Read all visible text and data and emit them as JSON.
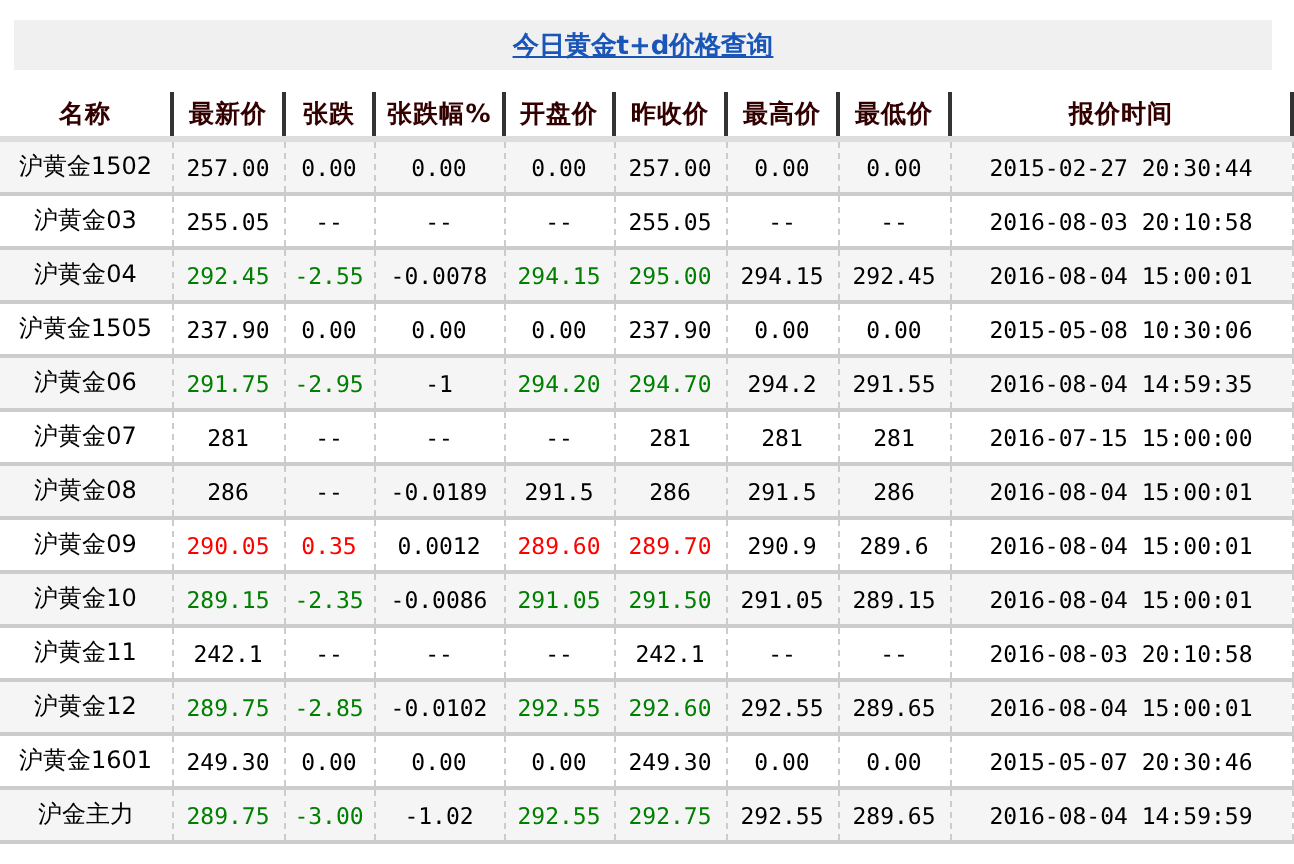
{
  "title": "今日黄金t+d价格查询",
  "columns": [
    {
      "label": "名称",
      "tinted": false
    },
    {
      "label": "最新价",
      "tinted": true
    },
    {
      "label": "张跌",
      "tinted": true
    },
    {
      "label": "张跌幅%",
      "tinted": false
    },
    {
      "label": "开盘价",
      "tinted": true
    },
    {
      "label": "昨收价",
      "tinted": true
    },
    {
      "label": "最高价",
      "tinted": false
    },
    {
      "label": "最低价",
      "tinted": false
    },
    {
      "label": "报价时间",
      "tinted": false
    }
  ],
  "rows": [
    {
      "color": "#000000",
      "cells": [
        "沪黄金1502",
        "257.00",
        "0.00",
        "0.00",
        "0.00",
        "257.00",
        "0.00",
        "0.00",
        "2015-02-27 20:30:44"
      ]
    },
    {
      "color": "#000000",
      "cells": [
        "沪黄金03",
        "255.05",
        "--",
        "--",
        "--",
        "255.05",
        "--",
        "--",
        "2016-08-03 20:10:58"
      ]
    },
    {
      "color": "#008000",
      "cells": [
        "沪黄金04",
        "292.45",
        "-2.55",
        "-0.0078",
        "294.15",
        "295.00",
        "294.15",
        "292.45",
        "2016-08-04 15:00:01"
      ]
    },
    {
      "color": "#000000",
      "cells": [
        "沪黄金1505",
        "237.90",
        "0.00",
        "0.00",
        "0.00",
        "237.90",
        "0.00",
        "0.00",
        "2015-05-08 10:30:06"
      ]
    },
    {
      "color": "#008000",
      "cells": [
        "沪黄金06",
        "291.75",
        "-2.95",
        "-1",
        "294.20",
        "294.70",
        "294.2",
        "291.55",
        "2016-08-04 14:59:35"
      ]
    },
    {
      "color": "#000000",
      "cells": [
        "沪黄金07",
        "281",
        "--",
        "--",
        "--",
        "281",
        "281",
        "281",
        "2016-07-15 15:00:00"
      ]
    },
    {
      "color": "#000000",
      "cells": [
        "沪黄金08",
        "286",
        "--",
        "-0.0189",
        "291.5",
        "286",
        "291.5",
        "286",
        "2016-08-04 15:00:01"
      ]
    },
    {
      "color": "#ff0000",
      "cells": [
        "沪黄金09",
        "290.05",
        "0.35",
        "0.0012",
        "289.60",
        "289.70",
        "290.9",
        "289.6",
        "2016-08-04 15:00:01"
      ]
    },
    {
      "color": "#008000",
      "cells": [
        "沪黄金10",
        "289.15",
        "-2.35",
        "-0.0086",
        "291.05",
        "291.50",
        "291.05",
        "289.15",
        "2016-08-04 15:00:01"
      ]
    },
    {
      "color": "#000000",
      "cells": [
        "沪黄金11",
        "242.1",
        "--",
        "--",
        "--",
        "242.1",
        "--",
        "--",
        "2016-08-03 20:10:58"
      ]
    },
    {
      "color": "#008000",
      "cells": [
        "沪黄金12",
        "289.75",
        "-2.85",
        "-0.0102",
        "292.55",
        "292.60",
        "292.55",
        "289.65",
        "2016-08-04 15:00:01"
      ]
    },
    {
      "color": "#000000",
      "cells": [
        "沪黄金1601",
        "249.30",
        "0.00",
        "0.00",
        "0.00",
        "249.30",
        "0.00",
        "0.00",
        "2015-05-07 20:30:46"
      ]
    },
    {
      "color": "#008000",
      "cells": [
        "沪金主力",
        "289.75",
        "-3.00",
        "-1.02",
        "292.55",
        "292.75",
        "292.55",
        "289.65",
        "2016-08-04 14:59:59"
      ]
    }
  ]
}
